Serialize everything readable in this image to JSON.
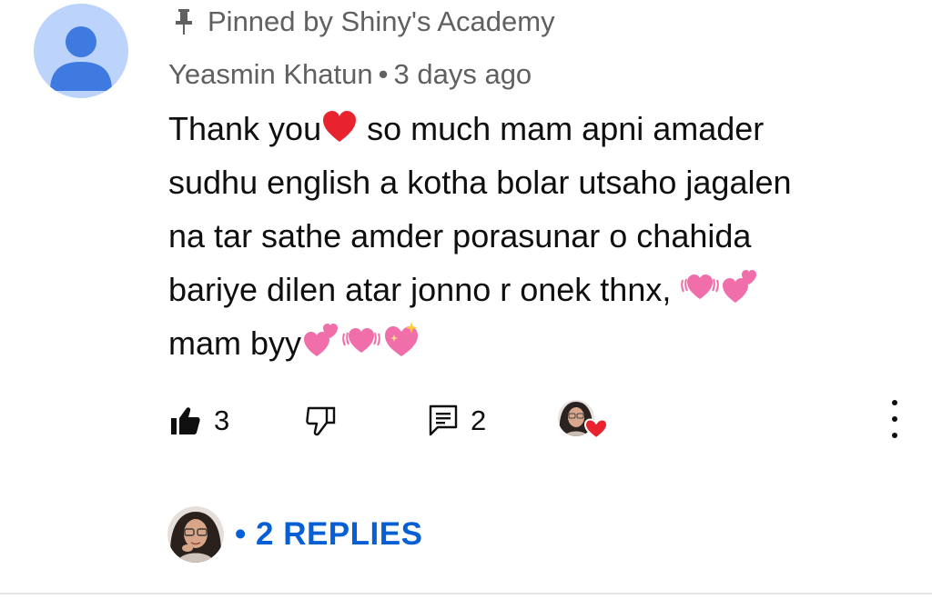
{
  "pinned": {
    "icon": "pin-icon",
    "text": "Pinned by Shiny's Academy"
  },
  "comment": {
    "author": "Yeasmin Khatun",
    "separator": "•",
    "timestamp": "3 days ago",
    "lines": [
      {
        "before": "Thank you",
        "emoji": "red-heart",
        "after": " so much mam  apni amader"
      },
      {
        "text": "sudhu english a kotha bolar utsaho jagalen"
      },
      {
        "text": "na tar sathe amder porasunar o chahida"
      },
      {
        "text": "bariye dilen atar jonno r onek thnx, "
      },
      {
        "text": "mam byy"
      }
    ],
    "line4_emojis": [
      "beating-heart",
      "two-hearts"
    ],
    "line5_emojis": [
      "two-hearts",
      "beating-heart",
      "sparkling-heart"
    ]
  },
  "actions": {
    "like_count": "3",
    "reply_count": "2",
    "icons": [
      "thumbs-up-icon",
      "thumbs-down-icon",
      "comment-icon",
      "creator-heart-icon",
      "more-vert-icon"
    ]
  },
  "replies": {
    "bullet": "•",
    "label": "2 REPLIES"
  },
  "colors": {
    "meta": "#606060",
    "text": "#0f0f0f",
    "link": "#065fd4",
    "avatar_bg": "#bcd3fb",
    "avatar_fg": "#3e7ae0",
    "heart_red": "#e8232e",
    "heart_pink": "#f06ea9"
  }
}
